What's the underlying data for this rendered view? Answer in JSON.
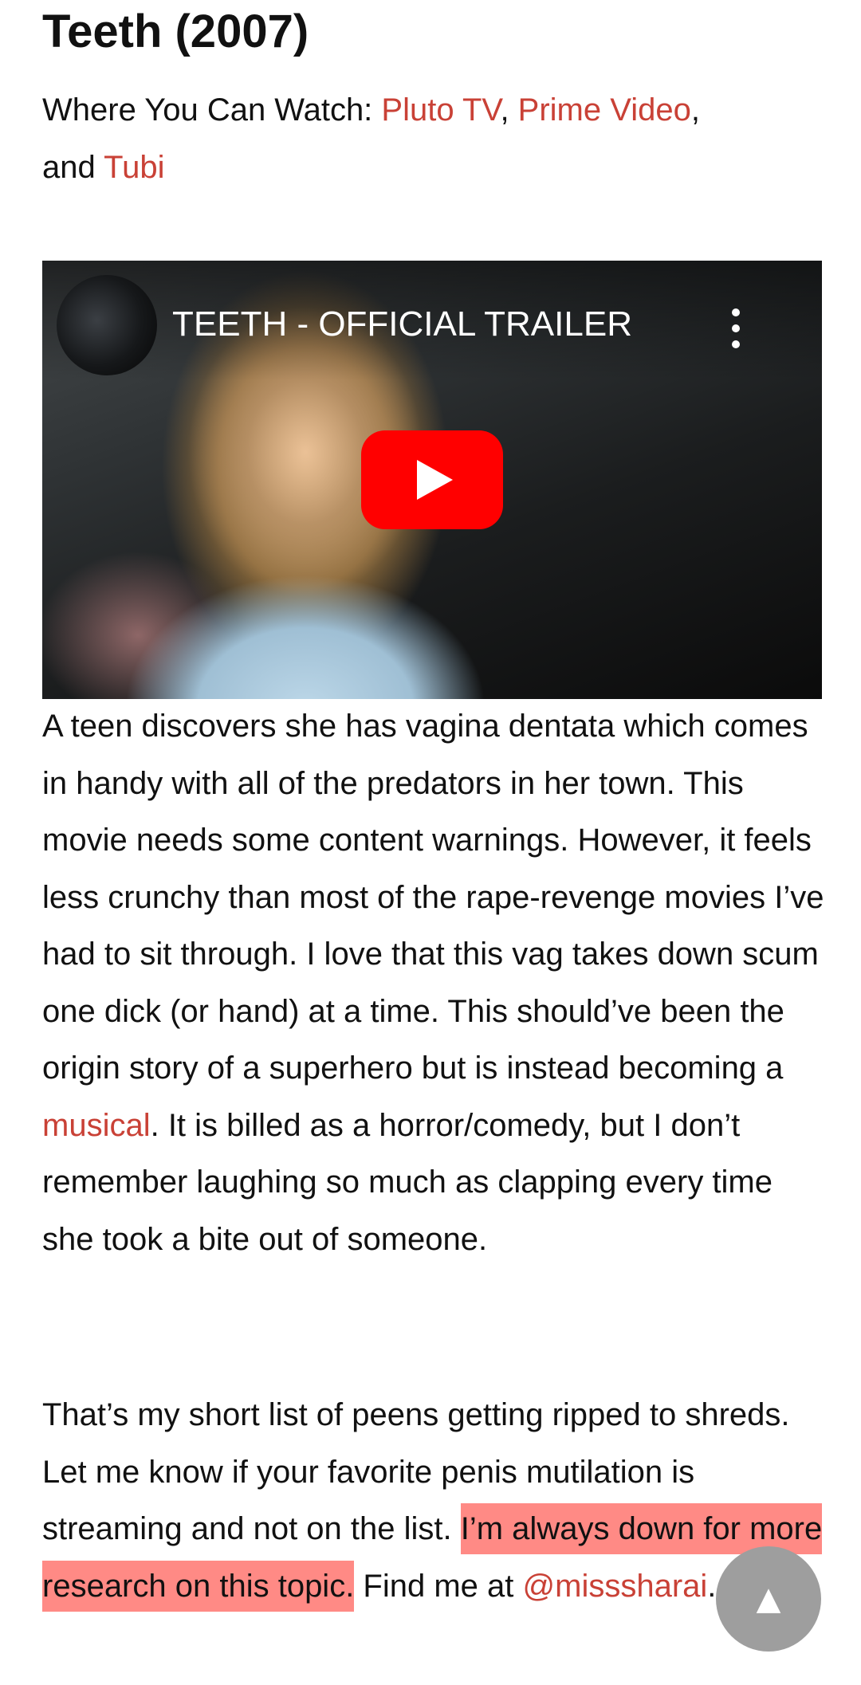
{
  "movie": {
    "title": "Teeth (2007)",
    "where_label": "Where You Can Watch: ",
    "services": [
      {
        "name": "Pluto TV"
      },
      {
        "name": "Prime Video"
      },
      {
        "name": "Tubi"
      }
    ],
    "comma_1": ", ",
    "comma_2": ",",
    "and_text": "and "
  },
  "video": {
    "title": "TEETH - OFFICIAL TRAILER",
    "menu_icon": "vertical-ellipsis-icon",
    "play_icon": "youtube-play-icon",
    "play_color": "#ff0000"
  },
  "review": {
    "part1": "A teen discovers she has vagina dentata which comes in handy with all of the predators in her town. This movie needs some content warnings. However, it feels less crunchy than most of the rape-revenge movies I’ve had to sit through. I love that this vag takes down scum one dick (or hand) at a time. This should’ve been the origin story of a superhero but is instead becoming a ",
    "link": "musical",
    "part2": ". It is billed as a horror/comedy, but I don’t remember laughing so much as clapping every time she took a bite out of someone."
  },
  "closing": {
    "part1": "That’s my short list of peens getting ripped to shreds. Let me know if your favorite penis mutilation is streaming and not on the list. ",
    "highlight": "I’m always down for more research on this topic.",
    "part2": " Find me at ",
    "handle": "@misssharai",
    "end": "."
  },
  "scroll_top": {
    "label": "▲",
    "icon": "up-arrow-icon"
  },
  "colors": {
    "link": "#c94136",
    "highlight": "#ff8a85",
    "scroll_button": "#9e9e9e"
  }
}
